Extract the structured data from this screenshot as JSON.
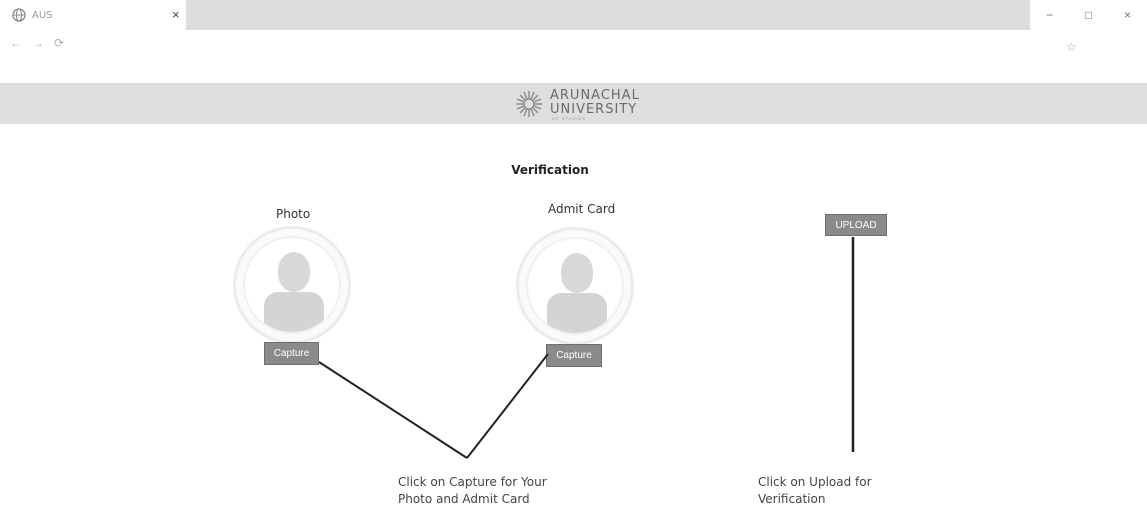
{
  "browser": {
    "tab_title": "AUS",
    "tab_close": "×",
    "win_minimize": "−",
    "win_restore": "□",
    "win_close": "×",
    "back": "←",
    "forward": "→",
    "reload": "⟳",
    "star": "☆"
  },
  "header": {
    "logo_line1": "ARUNACHAL",
    "logo_line2": "UNIVERSITY",
    "logo_tagline": "OF STUDIES"
  },
  "page": {
    "title": "Verification",
    "photo": {
      "label": "Photo",
      "button": "Capture"
    },
    "admit_card": {
      "label": "Admit Card",
      "button": "Capture"
    },
    "upload_button": "UPLOAD",
    "note_capture_line1": "Click on Capture for Your",
    "note_capture_line2": "Photo and Admit Card",
    "note_upload_line1": "Click on Upload for",
    "note_upload_line2": "Verification"
  },
  "colors": {
    "button_bg": "#8a8a8a",
    "header_bg": "#dedede",
    "line": "#222222"
  }
}
